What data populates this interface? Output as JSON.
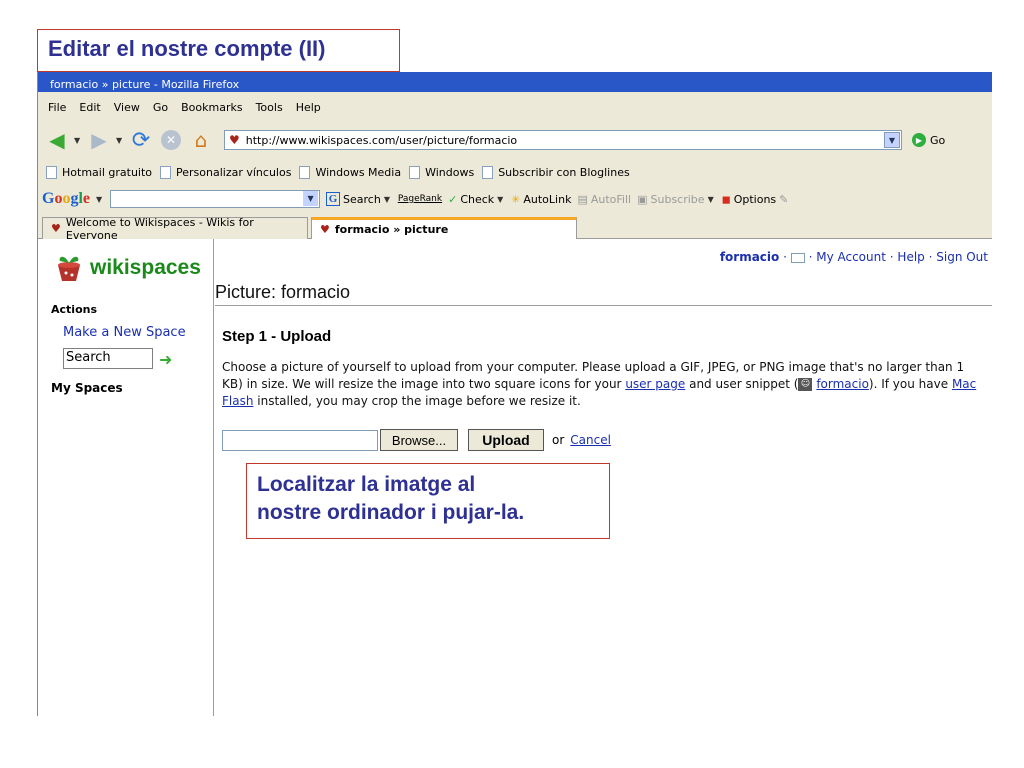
{
  "slide": {
    "title": "Editar el nostre compte (II)",
    "callout_line1": "Localitzar la imatge al",
    "callout_line2": "nostre ordinador i pujar-la."
  },
  "browser": {
    "window_title": "formacio » picture - Mozilla Firefox",
    "menu": [
      "File",
      "Edit",
      "View",
      "Go",
      "Bookmarks",
      "Tools",
      "Help"
    ],
    "url": "http://www.wikispaces.com/user/picture/formacio",
    "go_label": "Go",
    "bookmarks": [
      "Hotmail gratuito",
      "Personalizar vínculos",
      "Windows Media",
      "Windows",
      "Subscribir con Bloglines"
    ],
    "google_toolbar": {
      "search_label": "Search",
      "pagerank_label": "PageRank",
      "check_label": "Check",
      "autolink_label": "AutoLink",
      "autofill_label": "AutoFill",
      "subscribe_label": "Subscribe",
      "options_label": "Options"
    },
    "tabs": [
      {
        "label": "Welcome to Wikispaces - Wikis for Everyone",
        "active": false
      },
      {
        "label": "formacio » picture",
        "active": true
      }
    ]
  },
  "page": {
    "logo_text": "wikispaces",
    "header_user": "formacio",
    "header_my_account": "My Account",
    "header_help": "Help",
    "header_sign_out": "Sign Out",
    "sidebar_actions": "Actions",
    "sidebar_new_space": "Make a New Space",
    "sidebar_search_value": "Search",
    "sidebar_my_spaces": "My Spaces",
    "heading": "Picture: formacio",
    "step_title": "Step 1 - Upload",
    "desc_part1": "Choose a picture of yourself to upload from your computer. Please upload a GIF, JPEG, or PNG image that's no larger than 1",
    "desc_part2": "KB) in size. We will resize the image into two square icons for your ",
    "desc_link_user_page": "user page",
    "desc_part3": " and user snippet (",
    "desc_link_formacio": "formacio",
    "desc_part4": "). If you have ",
    "desc_link_mac": "Mac",
    "desc_link_flash": "Flash",
    "desc_part5": " installed, you may crop the image before we resize it.",
    "browse_label": "Browse...",
    "upload_label": "Upload",
    "or_label": "or",
    "cancel_label": "Cancel"
  },
  "colors": {
    "slide_title_text": "#2e3192",
    "slide_border": "#c0392b",
    "link": "#1a2fb0",
    "logo_green": "#1a8a1a"
  }
}
